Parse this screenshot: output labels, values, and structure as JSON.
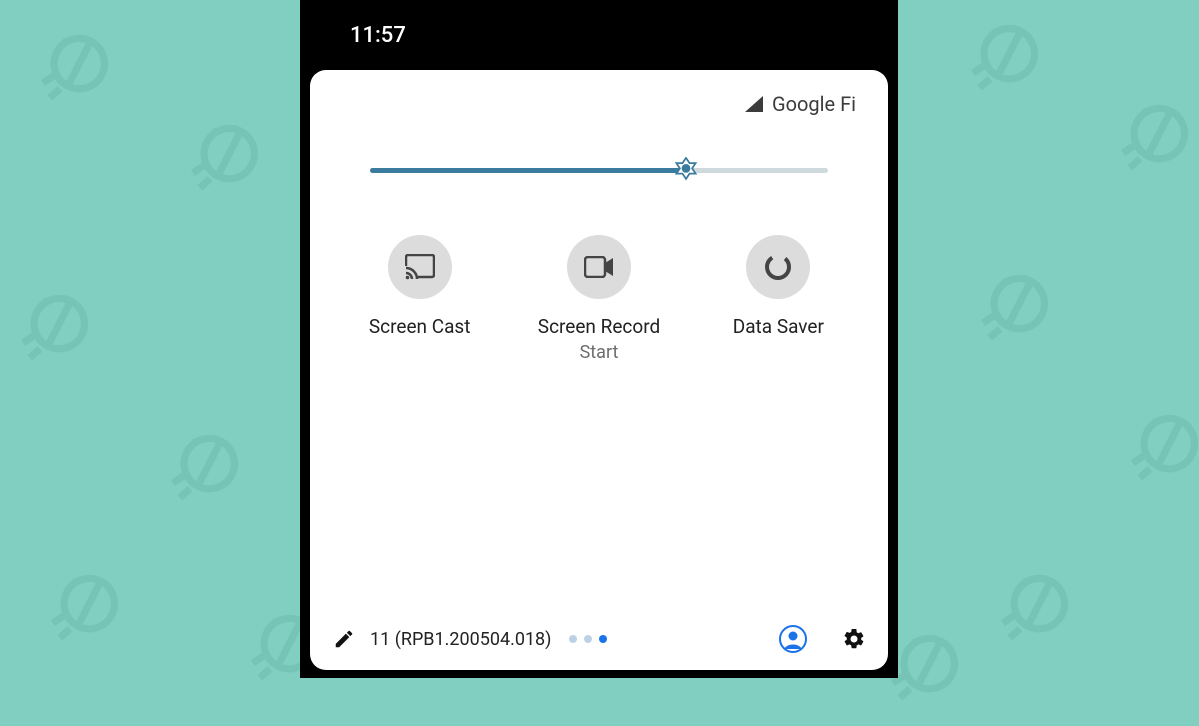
{
  "status_bar": {
    "time": "11:57"
  },
  "carrier": {
    "label": "Google Fi"
  },
  "brightness": {
    "percent": 69
  },
  "tiles": [
    {
      "label": "Screen Cast",
      "sub": "",
      "icon": "cast"
    },
    {
      "label": "Screen Record",
      "sub": "Start",
      "icon": "video"
    },
    {
      "label": "Data Saver",
      "sub": "",
      "icon": "datasaver"
    }
  ],
  "footer": {
    "build": "11 (RPB1.200504.018)",
    "page_count": 3,
    "active_page": 2
  },
  "colors": {
    "accent": "#3b7b9e",
    "blue": "#1a73e8",
    "tile_bg": "#dcdcdc"
  }
}
